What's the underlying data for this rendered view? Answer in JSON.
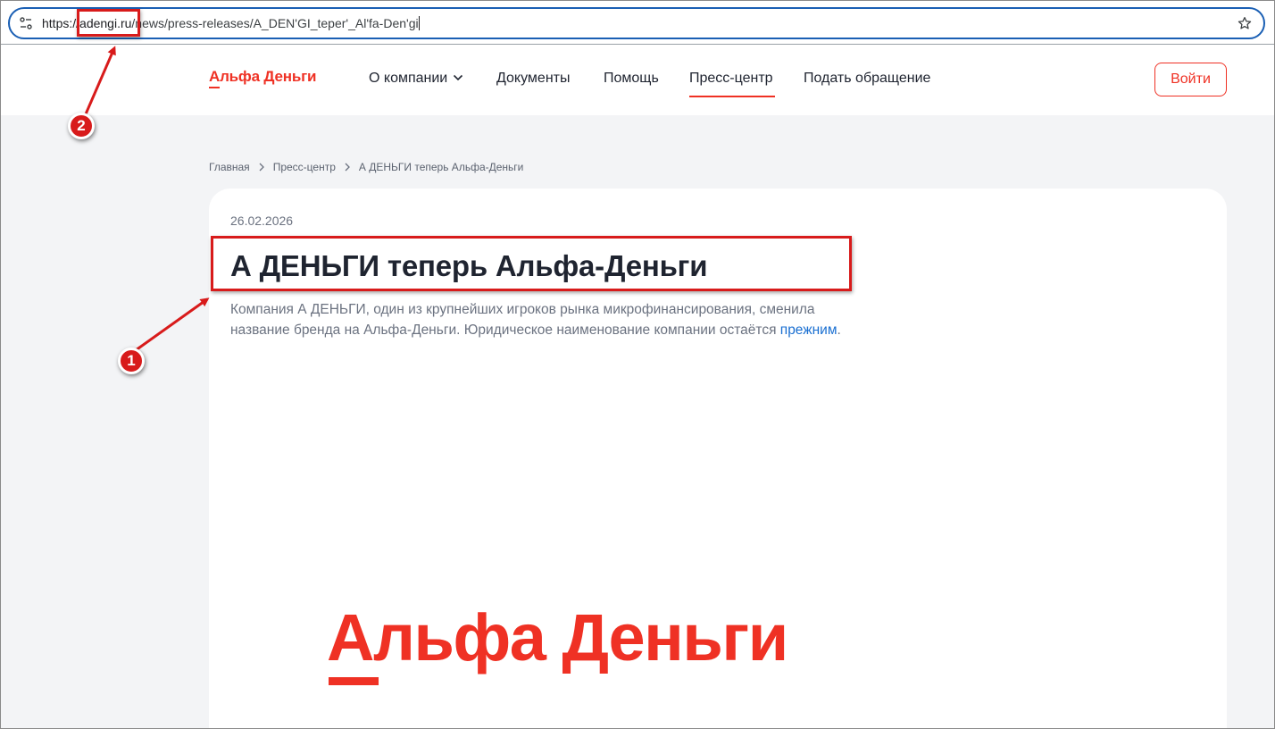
{
  "browser": {
    "url_scheme": "https://",
    "url_host": "adengi.ru",
    "url_path": "/news/press-releases/A_DEN'GI_teper'_Al'fa-Den'gi"
  },
  "header": {
    "logo": "Альфа Деньги",
    "nav": {
      "about": "О компании",
      "documents": "Документы",
      "help": "Помощь",
      "press": "Пресс-центр",
      "appeal": "Подать обращение"
    },
    "login": "Войти"
  },
  "breadcrumb": {
    "home": "Главная",
    "press": "Пресс-центр",
    "current": "А ДЕНЬГИ теперь Альфа-Деньги"
  },
  "article": {
    "date": "26.02.2026",
    "title": "А ДЕНЬГИ теперь Альфа-Деньги",
    "lead": "Компания А ДЕНЬГИ, один из крупнейших игроков рынка микрофинансирования, сменила название бренда на Альфа-Деньги. Юридическое наименование компании остаётся ",
    "lead_link": "прежним",
    "lead_end": ".",
    "image_logo": "Альфа Деньги"
  },
  "annotations": {
    "badge1": "1",
    "badge2": "2"
  },
  "colors": {
    "brand_red": "#ef3124",
    "annotation_red": "#d81b1b",
    "link_blue": "#1a6fd1",
    "page_bg": "#f3f4f6"
  }
}
